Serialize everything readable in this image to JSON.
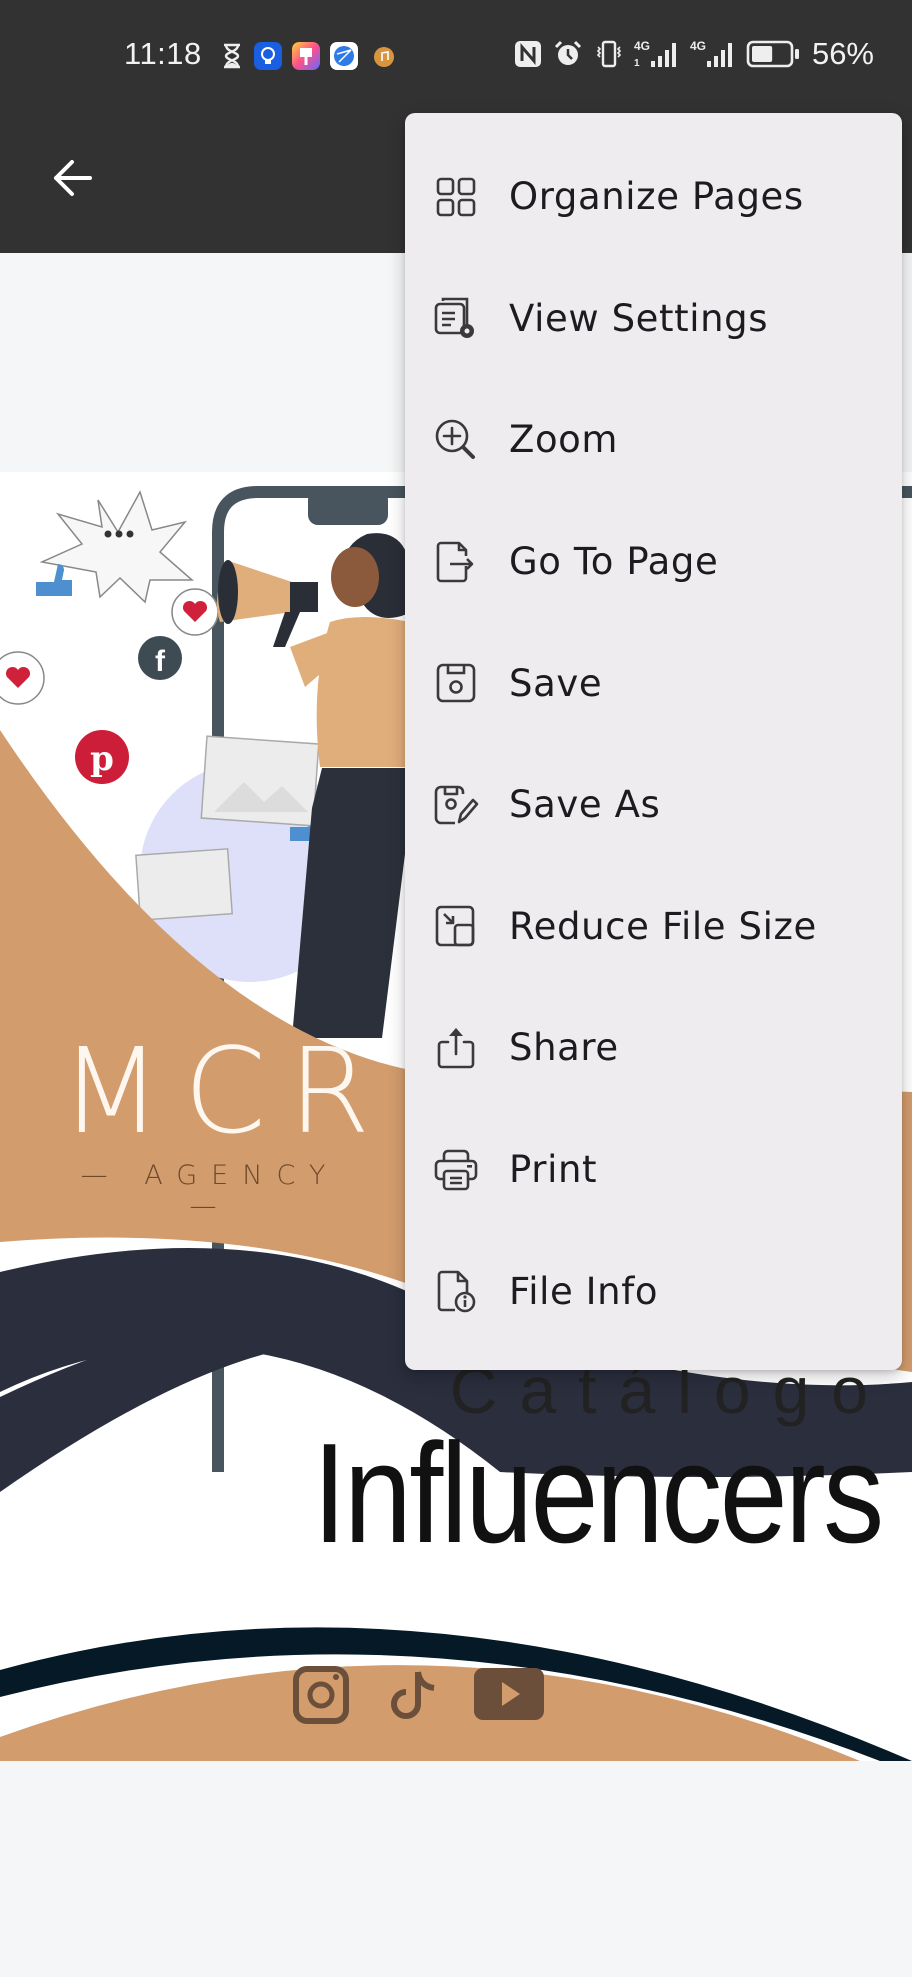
{
  "status_bar": {
    "time": "11:18",
    "notification_icons": [
      "hourglass-icon",
      "bulb-app-icon",
      "themes-app-icon",
      "browser-app-icon",
      "music-app-icon"
    ],
    "system_icons": [
      "nfc-icon",
      "alarm-icon",
      "vibrate-icon",
      "signal-4g-sim1-icon",
      "signal-4g-sim2-icon",
      "battery-icon"
    ],
    "battery_percent": "56%",
    "battery_level": 0.56
  },
  "toolbar": {
    "back_icon": "arrow-left-icon"
  },
  "document": {
    "logo_main": "MCR",
    "logo_sub": "AGENCY",
    "title_line1": "Catálogo",
    "title_line2": "Influencers",
    "social_icons": [
      "instagram-icon",
      "tiktok-icon",
      "youtube-icon"
    ],
    "colors": {
      "tan": "#d29c6d",
      "navy": "#2a2e3d",
      "dark_navy": "#051927",
      "brown": "#6b4f3a"
    }
  },
  "menu": {
    "items": [
      {
        "label": "Organize Pages",
        "icon": "grid-icon"
      },
      {
        "label": "View Settings",
        "icon": "view-settings-icon"
      },
      {
        "label": "Zoom",
        "icon": "zoom-in-icon"
      },
      {
        "label": "Go To Page",
        "icon": "go-to-page-icon"
      },
      {
        "label": "Save",
        "icon": "save-icon"
      },
      {
        "label": "Save As",
        "icon": "save-as-icon"
      },
      {
        "label": "Reduce File Size",
        "icon": "reduce-file-size-icon"
      },
      {
        "label": "Share",
        "icon": "share-icon"
      },
      {
        "label": "Print",
        "icon": "print-icon"
      },
      {
        "label": "File Info",
        "icon": "file-info-icon"
      }
    ]
  }
}
